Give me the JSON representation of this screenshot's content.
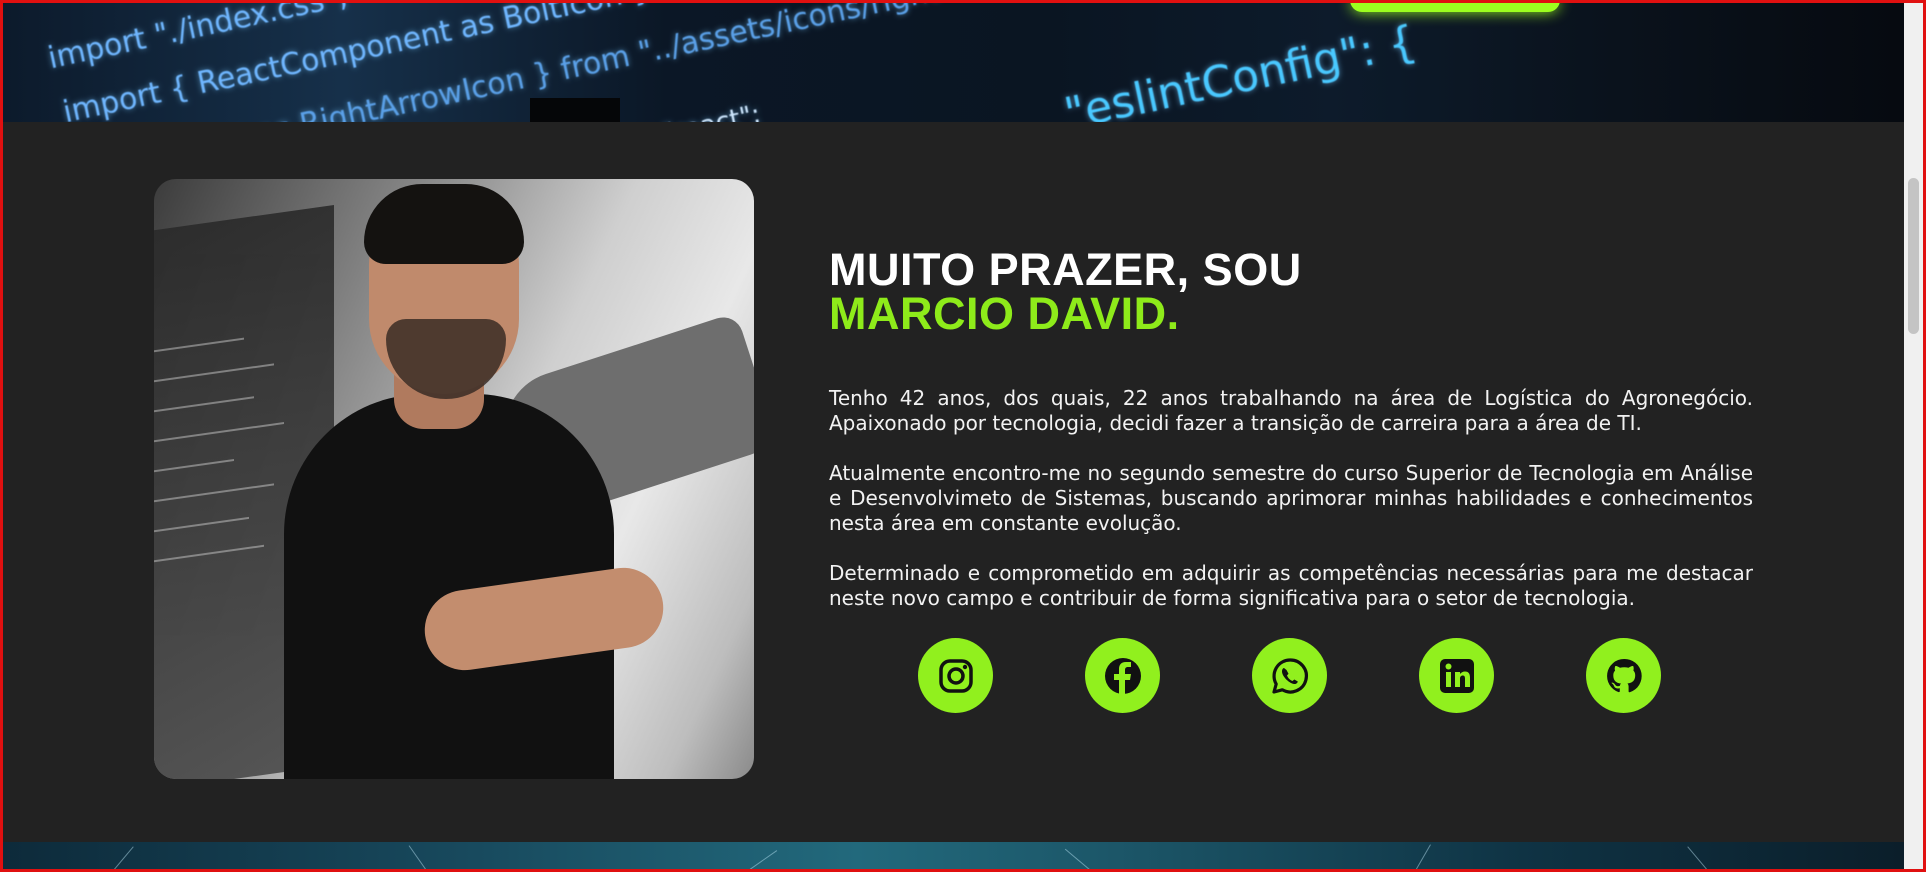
{
  "banner_top": {
    "code_lines": [
      "import \"./index.css\";",
      "import { ReactComponent as BoltIcon } from \"../assets/icons/bolt\"",
      "...nent as RightArrowIcon } from \"../assets/icons/right",
      "\"eslintConfig\": {",
      "\"react\";"
    ]
  },
  "about": {
    "photo_alt": "Marcio David",
    "headline_line1": "MUITO PRAZER, SOU",
    "headline_line2": "MARCIO DAVID.",
    "paragraphs": [
      "Tenho 42 anos, dos quais, 22 anos trabalhando na área de Logística do Agronegócio. Apaixonado por tecnologia, decidi fazer a transição de carreira para a área de TI.",
      "Atualmente encontro-me no segundo semestre do curso Superior de Tecnologia em Análise e Desenvolvimeto de Sistemas, buscando aprimorar minhas habilidades e conhecimentos nesta área em constante evolução.",
      "Determinado e comprometido em adquirir as competências necessárias para me destacar neste novo campo e contribuir de forma significativa para o setor de tecnologia."
    ],
    "socials": [
      {
        "icon": "instagram-icon"
      },
      {
        "icon": "facebook-icon"
      },
      {
        "icon": "whatsapp-icon"
      },
      {
        "icon": "linkedin-icon"
      },
      {
        "icon": "github-icon"
      }
    ]
  },
  "colors": {
    "accent": "#8eeb1a",
    "icon_bg": "#91f01e",
    "section_bg": "#222222",
    "frame": "#e01010"
  }
}
